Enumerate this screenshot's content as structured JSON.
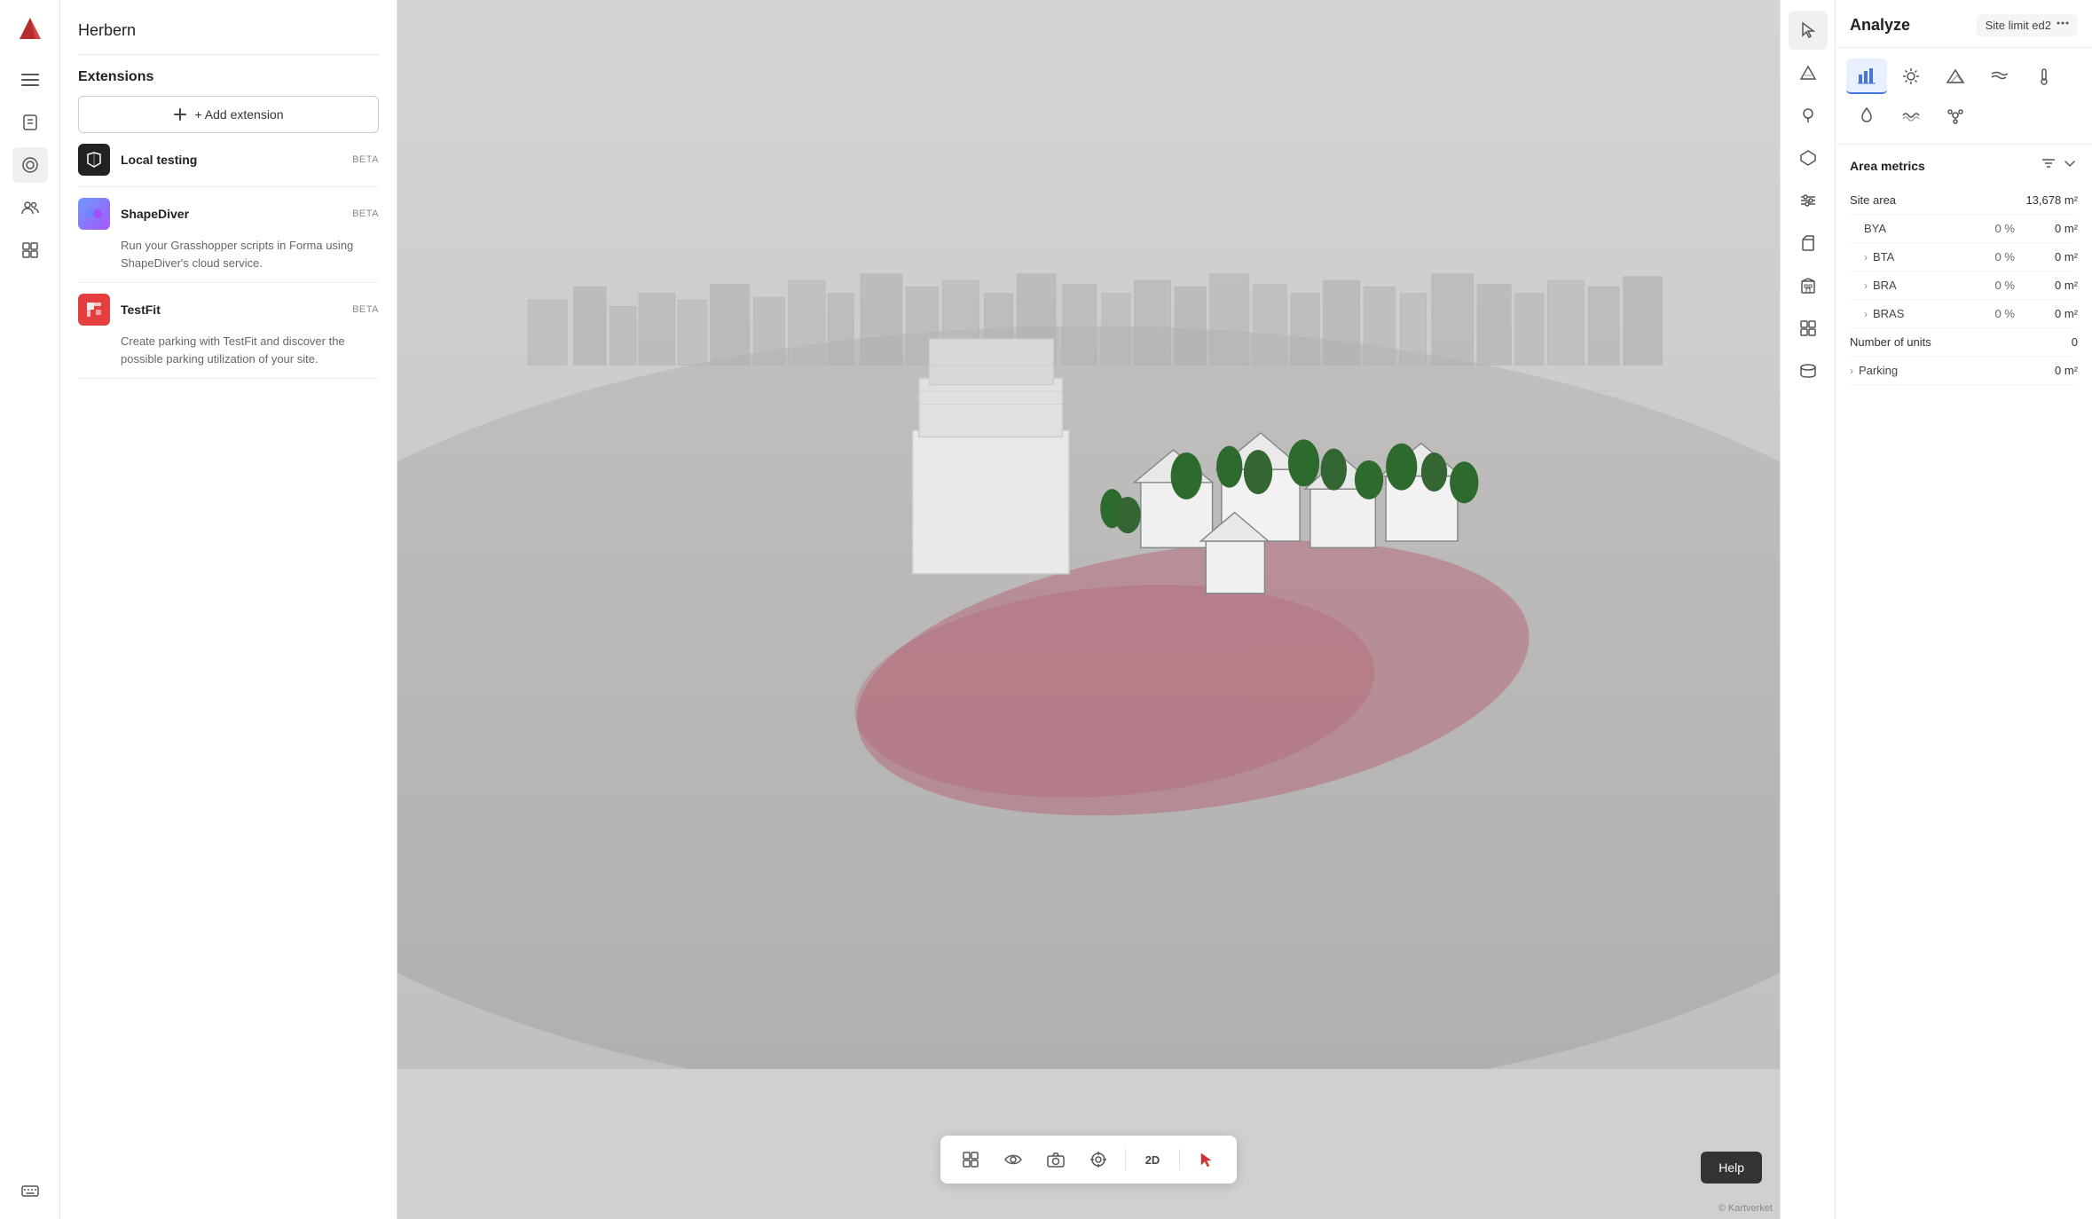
{
  "app": {
    "logo_label": "Forma",
    "project_name": "Herbern"
  },
  "left_sidebar": {
    "icons": [
      {
        "name": "hamburger-menu-icon",
        "symbol": "☰",
        "interactable": true
      },
      {
        "name": "book-icon",
        "symbol": "📖",
        "interactable": true
      },
      {
        "name": "layers-icon",
        "symbol": "⊛",
        "interactable": true
      },
      {
        "name": "users-icon",
        "symbol": "👥",
        "interactable": true
      },
      {
        "name": "grid-icon",
        "symbol": "⊞",
        "interactable": true
      },
      {
        "name": "keyboard-icon",
        "symbol": "⌨",
        "interactable": true
      }
    ]
  },
  "extensions_panel": {
    "title": "Extensions",
    "add_button_label": "+ Add extension",
    "extensions": [
      {
        "id": "local-testing",
        "name": "Local testing",
        "badge": "BETA",
        "description": "",
        "icon_type": "local"
      },
      {
        "id": "shapediver",
        "name": "ShapeDiver",
        "badge": "BETA",
        "description": "Run your Grasshopper scripts in Forma using ShapeDiver's cloud service.",
        "icon_type": "shapediver"
      },
      {
        "id": "testfit",
        "name": "TestFit",
        "badge": "BETA",
        "description": "Create parking with TestFit and discover the possible parking utilization of your site.",
        "icon_type": "testfit"
      }
    ]
  },
  "right_toolbar": {
    "icons": [
      {
        "name": "cursor-icon",
        "symbol": "↖",
        "active": true
      },
      {
        "name": "terrain-icon",
        "symbol": "◈",
        "active": false
      },
      {
        "name": "tree-icon",
        "symbol": "🌲",
        "active": false
      },
      {
        "name": "polygon-icon",
        "symbol": "⬡",
        "active": false
      },
      {
        "name": "building-icon",
        "symbol": "⬡",
        "active": false
      },
      {
        "name": "sliders-icon",
        "symbol": "⚡",
        "active": false
      },
      {
        "name": "3d-box-icon",
        "symbol": "◻",
        "active": false
      },
      {
        "name": "3d-stack-icon",
        "symbol": "⬡",
        "active": false
      },
      {
        "name": "blocks-icon",
        "symbol": "⊞",
        "active": false
      }
    ]
  },
  "viewport_toolbar": {
    "buttons": [
      {
        "name": "grid-view-btn",
        "symbol": "⊞",
        "label": ""
      },
      {
        "name": "eye-btn",
        "symbol": "👁",
        "label": ""
      },
      {
        "name": "camera-btn",
        "symbol": "📷",
        "label": ""
      },
      {
        "name": "target-btn",
        "symbol": "◎",
        "label": ""
      },
      {
        "name": "2d-btn",
        "label": "2D"
      },
      {
        "name": "cursor-red-btn",
        "symbol": "↖",
        "label": ""
      }
    ]
  },
  "analyze_panel": {
    "title": "Analyze",
    "site_limit_label": "Site limit ed2",
    "icon_tabs": [
      {
        "name": "bar-chart-tab",
        "symbol": "📊",
        "active": true
      },
      {
        "name": "sun-tab",
        "symbol": "☀"
      },
      {
        "name": "mountain-tab",
        "symbol": "⛰"
      },
      {
        "name": "wind-tab",
        "symbol": "💨"
      },
      {
        "name": "temperature-tab",
        "symbol": "🌡"
      },
      {
        "name": "water-tab",
        "symbol": "💧"
      },
      {
        "name": "wave-tab",
        "symbol": "〜"
      },
      {
        "name": "molecule-tab",
        "symbol": "⚛"
      }
    ],
    "area_metrics": {
      "title": "Area metrics",
      "rows": [
        {
          "label": "Site area",
          "pct": "",
          "value": "13,678 m²",
          "indent": false,
          "has_chevron": false
        },
        {
          "label": "BYA",
          "pct": "0 %",
          "value": "0 m²",
          "indent": true,
          "has_chevron": false
        },
        {
          "label": "BTA",
          "pct": "0 %",
          "value": "0 m²",
          "indent": true,
          "has_chevron": true
        },
        {
          "label": "BRA",
          "pct": "0 %",
          "value": "0 m²",
          "indent": true,
          "has_chevron": true
        },
        {
          "label": "BRAS",
          "pct": "0 %",
          "value": "0 m²",
          "indent": true,
          "has_chevron": true
        },
        {
          "label": "Number of units",
          "pct": "",
          "value": "0",
          "indent": false,
          "has_chevron": false
        },
        {
          "label": "Parking",
          "pct": "",
          "value": "0 m²",
          "indent": false,
          "has_chevron": true
        }
      ]
    }
  },
  "help_button": {
    "label": "Help"
  },
  "footer": {
    "credit": "© Kartverket"
  }
}
